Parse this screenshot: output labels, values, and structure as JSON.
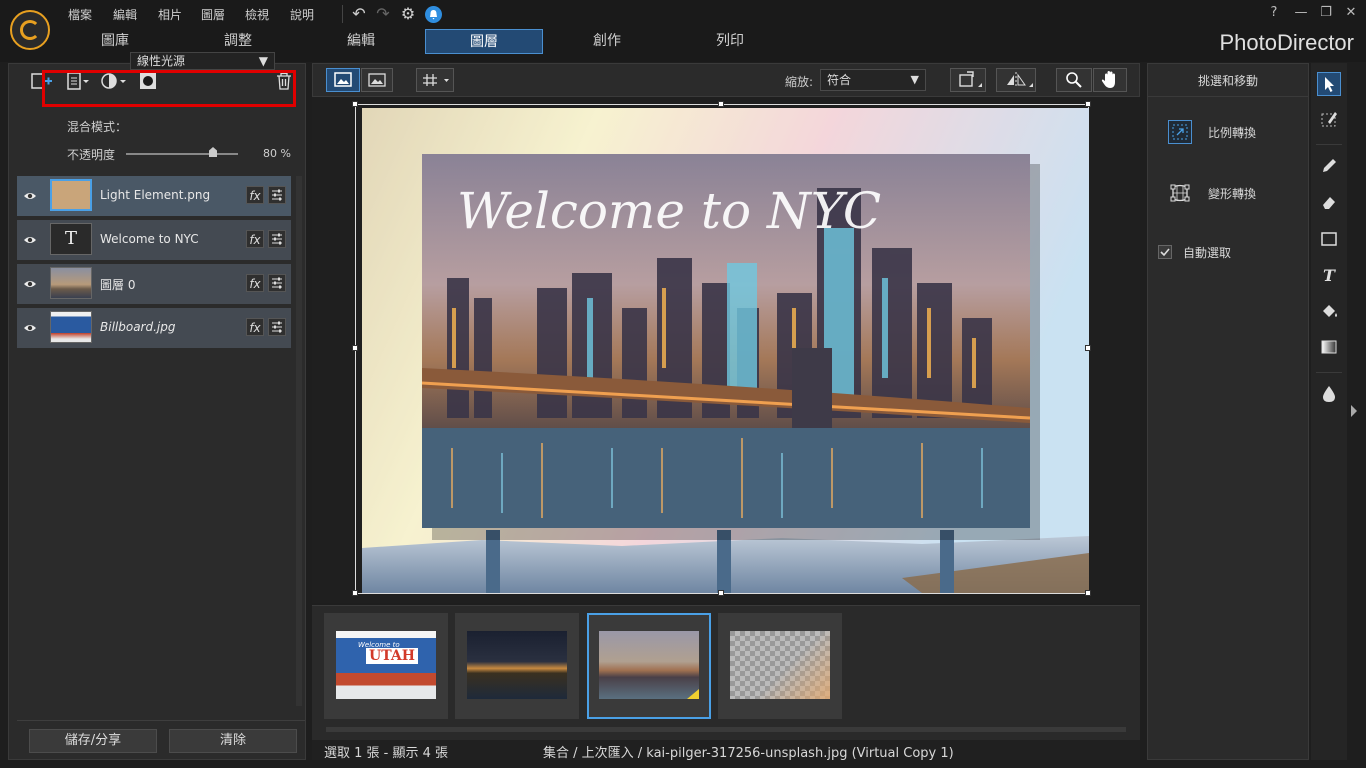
{
  "menu": [
    "檔案",
    "編輯",
    "相片",
    "圖層",
    "檢視",
    "說明"
  ],
  "modes": [
    "圖庫",
    "調整",
    "編輯",
    "圖層",
    "創作",
    "列印"
  ],
  "active_mode": "圖層",
  "brand": "PhotoDirector",
  "window_controls": {
    "help": "?",
    "minimize": "—",
    "restore": "❐",
    "close": "✕"
  },
  "layer_panel": {
    "blend_label": "混合模式：",
    "blend_value": "線性光源",
    "opacity_label": "不透明度",
    "opacity_value": "80 %",
    "opacity_fraction": 0.8,
    "layers": [
      {
        "name": "Light Element.png",
        "thumb": "checker",
        "selected": true,
        "italic": false
      },
      {
        "name": "Welcome to NYC",
        "thumb": "text",
        "selected": false,
        "italic": false
      },
      {
        "name": "圖層 0",
        "thumb": "city",
        "selected": false,
        "italic": false
      },
      {
        "name": "Billboard.jpg",
        "thumb": "utah",
        "selected": false,
        "italic": true
      }
    ],
    "fx_label": "fx",
    "thumb_text_glyph": "T",
    "save_share": "儲存/分享",
    "clear": "清除"
  },
  "toolbar": {
    "zoom_label": "縮放:",
    "zoom_value": "符合"
  },
  "canvas": {
    "billboard_text": "Welcome to NYC"
  },
  "filmstrip": {
    "thumbs": [
      "utah",
      "nyc",
      "nyc-selected",
      "light"
    ],
    "utah_text": "UTAH",
    "utah_subtext": "Welcome to"
  },
  "status": {
    "left": "選取 1 張 - 顯示 4 張",
    "center": "集合 / 上次匯入 / kai-pilger-317256-unsplash.jpg (Virtual Copy 1)"
  },
  "right_panel": {
    "title": "挑選和移動",
    "scale_transform": "比例轉換",
    "warp_transform": "變形轉換",
    "auto_select": "自動選取"
  }
}
